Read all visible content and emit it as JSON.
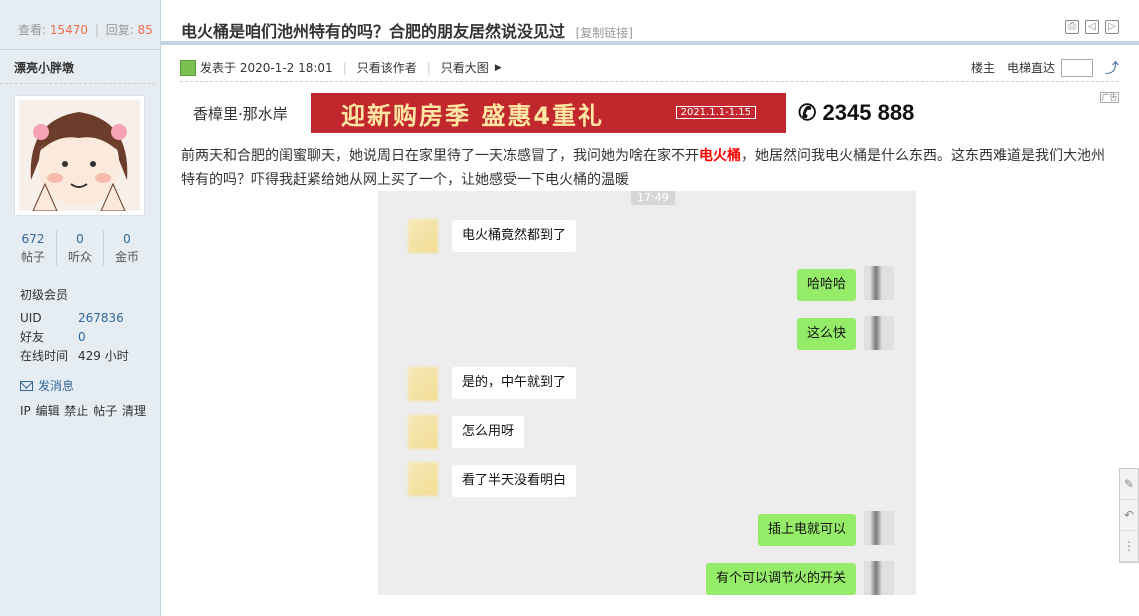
{
  "stats": {
    "views_label": "查看:",
    "views": "15470",
    "replies_label": "回复:",
    "replies": "85"
  },
  "author": {
    "name": "漂亮小胖墩",
    "posts": "672",
    "posts_label": "帖子",
    "fans": "0",
    "fans_label": "听众",
    "coins": "0",
    "coins_label": "金币",
    "rank": "初级会员",
    "uid_label": "UID",
    "uid": "267836",
    "friends_label": "好友",
    "friends": "0",
    "online_label": "在线时间",
    "online": "429 小时",
    "pm_label": "发消息",
    "admin_links": "IP 编辑 禁止 帖子 清理"
  },
  "thread": {
    "title": "电火桶是咱们池州特有的吗？合肥的朋友居然说没见过",
    "copy_link": "[复制链接]"
  },
  "post": {
    "posted": "发表于 2020-1-2 18:01",
    "only_author": "只看该作者",
    "only_big": "只看大图",
    "floor_owner": "楼主",
    "elevator": "电梯直达"
  },
  "banner": {
    "brand": "香樟里·那水岸",
    "slogan": "迎新购房季 盛惠4重礼",
    "date": "2021.1.1-1.15",
    "phone": "2345 888",
    "tag": "广告"
  },
  "body": {
    "part1": "前两天和合肥的闺蜜聊天，她说周日在家里待了一天冻感冒了，我问她为啥在家不开",
    "highlight": "电火桶",
    "part2": "，她居然问我电火桶是什么东西。这东西难道是我们大池州特有的吗？吓得我赶紧给她从网上买了一个，让她感受一下电火桶的温暖"
  },
  "chat": {
    "time": "17:49",
    "messages": [
      {
        "side": "in",
        "text": "电火桶竟然都到了"
      },
      {
        "side": "out",
        "text": "哈哈哈"
      },
      {
        "side": "out",
        "text": "这么快"
      },
      {
        "side": "in",
        "text": "是的，中午就到了"
      },
      {
        "side": "in",
        "text": "怎么用呀"
      },
      {
        "side": "in",
        "text": "看了半天没看明白"
      },
      {
        "side": "out",
        "text": "插上电就可以"
      },
      {
        "side": "out",
        "text": "有个可以调节火的开关"
      }
    ]
  },
  "colors": {
    "accent_red": "#f26c4f",
    "link_blue": "#336699",
    "sidebar_bg": "#e5edf2",
    "wechat_green": "#95ec69"
  }
}
